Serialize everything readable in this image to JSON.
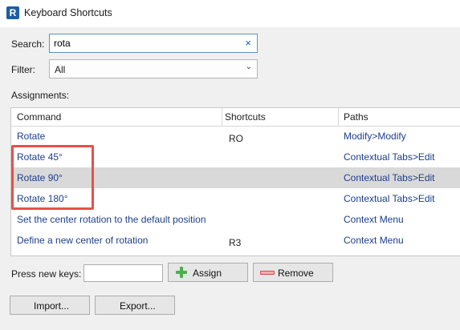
{
  "window": {
    "title": "Keyboard Shortcuts",
    "app_icon_letter": "R"
  },
  "search": {
    "label": "Search:",
    "value": "rota",
    "clear_glyph": "×"
  },
  "filter": {
    "label": "Filter:",
    "selected": "All"
  },
  "assignments": {
    "label": "Assignments:",
    "columns": [
      "Command",
      "Shortcuts",
      "Paths"
    ],
    "rows": [
      {
        "command": "Rotate",
        "shortcut": "RO",
        "path": "Modify>Modify"
      },
      {
        "command": "Rotate 45°",
        "shortcut": "",
        "path": "Contextual Tabs>Edit"
      },
      {
        "command": "Rotate 90°",
        "shortcut": "",
        "path": "Contextual Tabs>Edit"
      },
      {
        "command": "Rotate 180°",
        "shortcut": "",
        "path": "Contextual Tabs>Edit"
      },
      {
        "command": "Set the center rotation to the default position",
        "shortcut": "",
        "path": "Context Menu"
      },
      {
        "command": "Define a new center of rotation",
        "shortcut": "R3",
        "path": "Context Menu"
      }
    ]
  },
  "new_keys": {
    "label": "Press new keys:",
    "value": ""
  },
  "buttons": {
    "assign": "Assign",
    "remove": "Remove",
    "import": "Import...",
    "export": "Export..."
  },
  "colors": {
    "highlight_box": "#e8504a",
    "selected_row": "#d9d9d9",
    "link_text": "#1c3f8a"
  }
}
